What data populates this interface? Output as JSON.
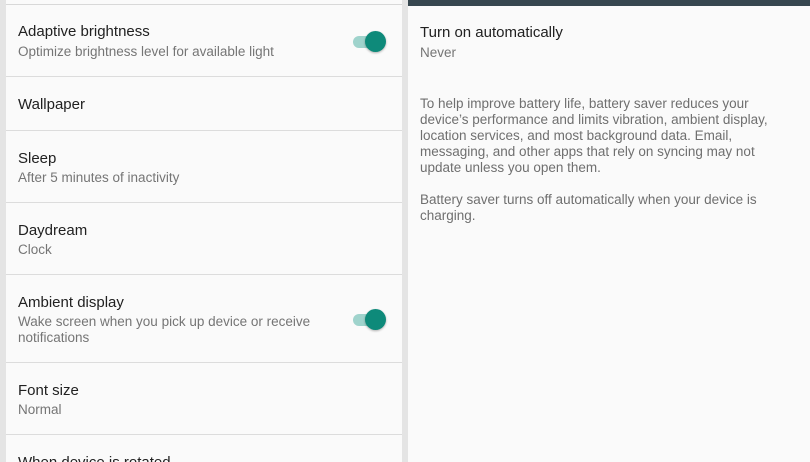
{
  "display_settings": {
    "items": [
      {
        "title": "Adaptive brightness",
        "subtitle": "Optimize brightness level for available light",
        "toggle_on": true
      },
      {
        "title": "Wallpaper"
      },
      {
        "title": "Sleep",
        "subtitle": "After 5 minutes of inactivity"
      },
      {
        "title": "Daydream",
        "subtitle": "Clock"
      },
      {
        "title": "Ambient display",
        "subtitle": "Wake screen when you pick up device or receive notifications",
        "toggle_on": true
      },
      {
        "title": "Font size",
        "subtitle": "Normal"
      },
      {
        "title": "When device is rotated"
      }
    ]
  },
  "battery_saver": {
    "turn_on_title": "Turn on automatically",
    "turn_on_value": "Never",
    "description_1": "To help improve battery life, battery saver reduces your device’s performance and limits vibration, ambient display, location services, and most background data. Email, messaging, and other apps that rely on syncing may not update unless you open them.",
    "description_2": "Battery saver turns off automatically when your device is charging."
  },
  "colors": {
    "toggle_accent": "#0e8a7a",
    "toggle_track": "#9fd3cc",
    "top_bar": "#37474f"
  }
}
